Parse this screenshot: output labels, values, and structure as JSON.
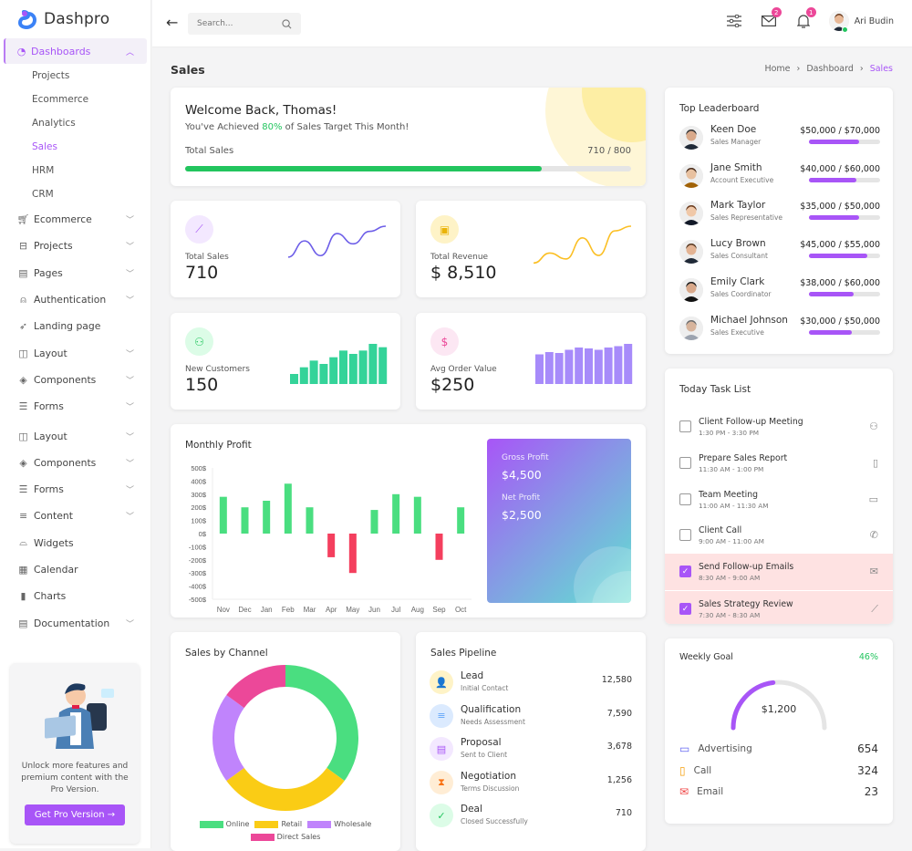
{
  "app": {
    "name": "Dashpro"
  },
  "sidebar": {
    "active_group": "Dashboards",
    "sub_items": [
      {
        "label": "Projects",
        "active": false
      },
      {
        "label": "Ecommerce",
        "active": false
      },
      {
        "label": "Analytics",
        "active": false
      },
      {
        "label": "Sales",
        "active": true
      },
      {
        "label": "HRM",
        "active": false
      },
      {
        "label": "CRM",
        "active": false
      }
    ],
    "items": [
      {
        "label": "Ecommerce",
        "icon": "cart-icon",
        "expandable": true
      },
      {
        "label": "Projects",
        "icon": "briefcase-icon",
        "expandable": true
      },
      {
        "label": "Pages",
        "icon": "file-icon",
        "expandable": true
      },
      {
        "label": "Authentication",
        "icon": "lock-icon",
        "expandable": true
      },
      {
        "label": "Landing page",
        "icon": "rocket-icon",
        "expandable": false
      },
      {
        "label": "Layout",
        "icon": "layout-icon",
        "expandable": true
      },
      {
        "label": "Components",
        "icon": "layers-icon",
        "expandable": true
      },
      {
        "label": "Forms",
        "icon": "form-icon",
        "expandable": true
      },
      {
        "label": "Layout",
        "icon": "layout-icon",
        "expandable": true
      },
      {
        "label": "Components",
        "icon": "layers-icon",
        "expandable": true
      },
      {
        "label": "Forms",
        "icon": "form-icon",
        "expandable": true
      },
      {
        "label": "Content",
        "icon": "content-icon",
        "expandable": true
      },
      {
        "label": "Widgets",
        "icon": "widget-icon",
        "expandable": false
      },
      {
        "label": "Calendar",
        "icon": "calendar-icon",
        "expandable": false
      },
      {
        "label": "Charts",
        "icon": "chart-icon",
        "expandable": false
      },
      {
        "label": "Documentation",
        "icon": "doc-icon",
        "expandable": true
      }
    ],
    "promo": {
      "text": "Unlock more features and premium content with the Pro Version.",
      "button": "Get Pro Version →"
    }
  },
  "topbar": {
    "search_placeholder": "Search...",
    "mail_badge": "2",
    "notif_badge": "1",
    "user_name": "Ari Budin"
  },
  "page": {
    "title": "Sales",
    "breadcrumb": [
      "Home",
      "Dashboard",
      "Sales"
    ]
  },
  "welcome": {
    "title": "Welcome Back, Thomas!",
    "sub_pre": "You've Achieved ",
    "sub_pct": "80%",
    "sub_post": " of Sales Target This Month!",
    "label": "Total Sales",
    "value": "710 / 800",
    "progress": 0.8
  },
  "stats": [
    {
      "label": "Total Sales",
      "value": "710",
      "color": "#6d5ee8",
      "icon_bg": "#f3e8ff",
      "type": "line",
      "series": [
        20,
        42,
        22,
        52,
        38,
        55,
        62
      ]
    },
    {
      "label": "Total Revenue",
      "value": "$ 8,510",
      "color": "#fbbf24",
      "icon_bg": "#fef3c7",
      "type": "line",
      "series": [
        15,
        32,
        22,
        58,
        28,
        70,
        78
      ]
    },
    {
      "label": "New Customers",
      "value": "150",
      "color": "#34d399",
      "icon_bg": "#dcfce7",
      "type": "bar",
      "series": [
        15,
        25,
        35,
        30,
        40,
        50,
        45,
        50,
        60,
        55
      ]
    },
    {
      "label": "Avg Order Value",
      "value": "$250",
      "color": "#a78bfa",
      "icon_bg": "#fce7f3",
      "type": "bar",
      "series": [
        65,
        70,
        68,
        75,
        80,
        78,
        75,
        80,
        83,
        88
      ]
    }
  ],
  "profit": {
    "title": "Monthly Profit",
    "gross_label": "Gross Profit",
    "gross_value": "$4,500",
    "net_label": "Net Profit",
    "net_value": "$2,500"
  },
  "chart_data": [
    {
      "type": "bar",
      "title": "Monthly Profit",
      "categories": [
        "Nov",
        "Dec",
        "Jan",
        "Feb",
        "Mar",
        "Apr",
        "May",
        "Jun",
        "Jul",
        "Aug",
        "Sep",
        "Oct"
      ],
      "values": [
        280,
        200,
        250,
        380,
        200,
        -180,
        -300,
        180,
        300,
        280,
        -200,
        200
      ],
      "yticks": [
        "500$",
        "400$",
        "300$",
        "200$",
        "100$",
        "0$",
        "-100$",
        "-200$",
        "-300$",
        "-400$",
        "-500$"
      ],
      "ylim": [
        -500,
        500
      ],
      "positive_color": "#4ade80",
      "negative_color": "#f43f5e",
      "grid": false
    },
    {
      "type": "pie",
      "title": "Sales by Channel",
      "categories": [
        "Online",
        "Retail",
        "Wholesale",
        "Direct Sales"
      ],
      "values": [
        35,
        30,
        20,
        15
      ],
      "colors": [
        "#4ade80",
        "#facc15",
        "#c084fc",
        "#ec4899"
      ],
      "legend": "bottom"
    }
  ],
  "pipeline": {
    "title": "Sales Pipeline",
    "rows": [
      {
        "name": "Lead",
        "sub": "Initial Contact",
        "value": "12,580",
        "bg": "#fef3c7",
        "fg": "#eab308",
        "icon": "user-plus-icon",
        "glyph": "👤"
      },
      {
        "name": "Qualification",
        "sub": "Needs Assessment",
        "value": "7,590",
        "bg": "#dbeafe",
        "fg": "#60a5fa",
        "icon": "filter-icon",
        "glyph": "≡"
      },
      {
        "name": "Proposal",
        "sub": "Sent to Client",
        "value": "3,678",
        "bg": "#f3e8ff",
        "fg": "#a855f7",
        "icon": "document-icon",
        "glyph": "▤"
      },
      {
        "name": "Negotiation",
        "sub": "Terms Discussion",
        "value": "1,256",
        "bg": "#ffedd5",
        "fg": "#f97316",
        "icon": "hourglass-icon",
        "glyph": "⧗"
      },
      {
        "name": "Deal",
        "sub": "Closed Successfully",
        "value": "710",
        "bg": "#dcfce7",
        "fg": "#22c55e",
        "icon": "check-circle-icon",
        "glyph": "✓"
      }
    ]
  },
  "leaderboard": {
    "title": "Top Leaderboard",
    "rows": [
      {
        "name": "Keen Doe",
        "role": "Sales Manager",
        "amount": "$50,000 / $70,000",
        "progress": 0.71
      },
      {
        "name": "Jane Smith",
        "role": "Account Executive",
        "amount": "$40,000 / $60,000",
        "progress": 0.67
      },
      {
        "name": "Mark Taylor",
        "role": "Sales Representative",
        "amount": "$35,000 / $50,000",
        "progress": 0.7
      },
      {
        "name": "Lucy Brown",
        "role": "Sales Consultant",
        "amount": "$45,000 / $55,000",
        "progress": 0.82
      },
      {
        "name": "Emily Clark",
        "role": "Sales Coordinator",
        "amount": "$38,000 / $60,000",
        "progress": 0.63
      },
      {
        "name": "Michael Johnson",
        "role": "Sales Executive",
        "amount": "$30,000 / $50,000",
        "progress": 0.6
      }
    ]
  },
  "tasks": {
    "title": "Today Task List",
    "rows": [
      {
        "name": "Client Follow-up Meeting",
        "time": "1:30 PM - 3:30 PM",
        "done": false,
        "icon": "user-gear-icon",
        "glyph": "⚇"
      },
      {
        "name": "Prepare Sales Report",
        "time": "11:30 AM - 1:00 PM",
        "done": false,
        "icon": "report-icon",
        "glyph": "▯"
      },
      {
        "name": "Team Meeting",
        "time": "11:00 AM - 11:30 AM",
        "done": false,
        "icon": "calendar-icon",
        "glyph": "▭"
      },
      {
        "name": "Client Call",
        "time": "9:00 AM - 11:00 AM",
        "done": false,
        "icon": "phone-icon",
        "glyph": "✆"
      },
      {
        "name": "Send Follow-up Emails",
        "time": "8:30 AM - 9:00 AM",
        "done": true,
        "icon": "mail-icon",
        "glyph": "✉"
      },
      {
        "name": "Sales Strategy Review",
        "time": "7:30 AM - 8:30 AM",
        "done": true,
        "icon": "trend-icon",
        "glyph": "⟋"
      }
    ]
  },
  "weekly": {
    "title": "Weekly Goal",
    "percent": "46%",
    "progress": 0.46,
    "value": "$1,200",
    "rows": [
      {
        "label": "Advertising",
        "value": "654",
        "icon": "laptop-icon",
        "color": "#6366f1"
      },
      {
        "label": "Call",
        "value": "324",
        "icon": "phone-icon",
        "color": "#f59e0b"
      },
      {
        "label": "Email",
        "value": "23",
        "icon": "mail-icon",
        "color": "#ef4444"
      }
    ]
  }
}
